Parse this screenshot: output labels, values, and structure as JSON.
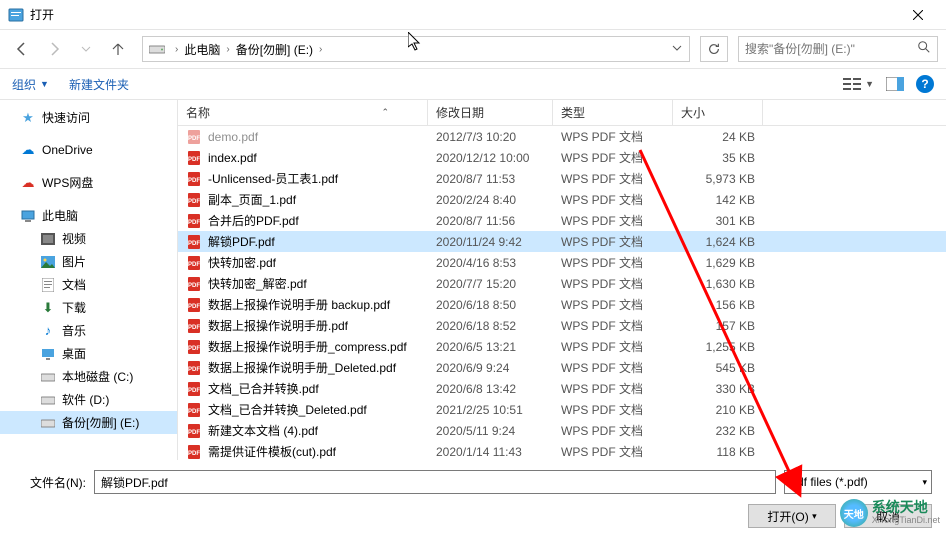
{
  "window": {
    "title": "打开"
  },
  "nav": {
    "crumb1": "此电脑",
    "crumb2": "备份[勿删] (E:)",
    "search_placeholder": "搜索\"备份[勿删] (E:)\""
  },
  "toolbar": {
    "organize": "组织",
    "newfolder": "新建文件夹"
  },
  "sidebar": {
    "quick": "快速访问",
    "onedrive": "OneDrive",
    "wps": "WPS网盘",
    "pc": "此电脑",
    "video": "视频",
    "pictures": "图片",
    "docs": "文档",
    "downloads": "下载",
    "music": "音乐",
    "desktop": "桌面",
    "drive_c": "本地磁盘 (C:)",
    "drive_d": "软件 (D:)",
    "drive_e": "备份[勿删] (E:)"
  },
  "columns": {
    "name": "名称",
    "date": "修改日期",
    "type": "类型",
    "size": "大小"
  },
  "files": [
    {
      "name": "demo.pdf",
      "date": "2012/7/3 10:20",
      "type": "WPS PDF 文档",
      "size": "24 KB",
      "truncated": true
    },
    {
      "name": "index.pdf",
      "date": "2020/12/12 10:00",
      "type": "WPS PDF 文档",
      "size": "35 KB"
    },
    {
      "name": "-Unlicensed-员工表1.pdf",
      "date": "2020/8/7 11:53",
      "type": "WPS PDF 文档",
      "size": "5,973 KB"
    },
    {
      "name": "副本_页面_1.pdf",
      "date": "2020/2/24 8:40",
      "type": "WPS PDF 文档",
      "size": "142 KB"
    },
    {
      "name": "合并后的PDF.pdf",
      "date": "2020/8/7 11:56",
      "type": "WPS PDF 文档",
      "size": "301 KB"
    },
    {
      "name": "解锁PDF.pdf",
      "date": "2020/11/24 9:42",
      "type": "WPS PDF 文档",
      "size": "1,624 KB",
      "selected": true
    },
    {
      "name": "快转加密.pdf",
      "date": "2020/4/16 8:53",
      "type": "WPS PDF 文档",
      "size": "1,629 KB"
    },
    {
      "name": "快转加密_解密.pdf",
      "date": "2020/7/7 15:20",
      "type": "WPS PDF 文档",
      "size": "1,630 KB"
    },
    {
      "name": "数据上报操作说明手册 backup.pdf",
      "date": "2020/6/18 8:50",
      "type": "WPS PDF 文档",
      "size": "156 KB"
    },
    {
      "name": "数据上报操作说明手册.pdf",
      "date": "2020/6/18 8:52",
      "type": "WPS PDF 文档",
      "size": "157 KB"
    },
    {
      "name": "数据上报操作说明手册_compress.pdf",
      "date": "2020/6/5 13:21",
      "type": "WPS PDF 文档",
      "size": "1,255 KB"
    },
    {
      "name": "数据上报操作说明手册_Deleted.pdf",
      "date": "2020/6/9 9:24",
      "type": "WPS PDF 文档",
      "size": "545 KB"
    },
    {
      "name": "文档_已合并转换.pdf",
      "date": "2020/6/8 13:42",
      "type": "WPS PDF 文档",
      "size": "330 KB"
    },
    {
      "name": "文档_已合并转换_Deleted.pdf",
      "date": "2021/2/25 10:51",
      "type": "WPS PDF 文档",
      "size": "210 KB"
    },
    {
      "name": "新建文本文档 (4).pdf",
      "date": "2020/5/11 9:24",
      "type": "WPS PDF 文档",
      "size": "232 KB"
    },
    {
      "name": "需提供证件模板(cut).pdf",
      "date": "2020/1/14 11:43",
      "type": "WPS PDF 文档",
      "size": "118 KB"
    }
  ],
  "footer": {
    "filename_label": "文件名(N):",
    "filename_value": "解锁PDF.pdf",
    "filetype": "Pdf files (*.pdf)",
    "open": "打开(O)",
    "cancel": "取消"
  },
  "watermark": {
    "cn": "系统天地",
    "url": "XiTongTianDi.net"
  }
}
